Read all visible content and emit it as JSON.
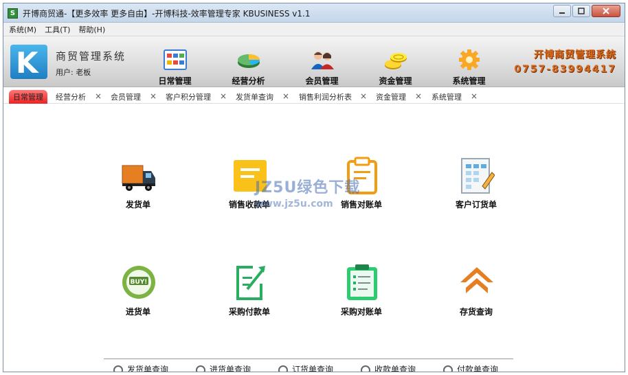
{
  "window": {
    "title": "开博商贸通-【更多效率 更多自由】-开博科技-效率管理专家  KBUSINESS v1.1",
    "icon_text": "S"
  },
  "window_controls": [
    "minimize-icon",
    "maximize-icon",
    "close-icon"
  ],
  "menu": [
    "系统(M)",
    "工具(T)",
    "帮助(H)"
  ],
  "header": {
    "logo_letter": "K",
    "app_name": "商贸管理系统",
    "user": "用户: 老板",
    "brand_title": "开博商贸管理系统",
    "brand_phone": "0757-83994417"
  },
  "nav": [
    {
      "label": "日常管理",
      "icon": "calendar-grid-icon"
    },
    {
      "label": "经营分析",
      "icon": "pie-chart-icon"
    },
    {
      "label": "会员管理",
      "icon": "users-icon"
    },
    {
      "label": "资金管理",
      "icon": "coins-icon"
    },
    {
      "label": "系统管理",
      "icon": "gear-icon"
    }
  ],
  "tabs": [
    {
      "label": "日常管理",
      "active": true
    },
    {
      "label": "经营分析"
    },
    {
      "label": "会员管理"
    },
    {
      "label": "客户积分管理"
    },
    {
      "label": "发货单查询"
    },
    {
      "label": "销售利润分析表"
    },
    {
      "label": "资金管理"
    },
    {
      "label": "系统管理"
    }
  ],
  "tiles": [
    {
      "label": "发货单",
      "icon": "truck-icon"
    },
    {
      "label": "销售收款单",
      "icon": "receipt-icon"
    },
    {
      "label": "销售对账单",
      "icon": "clipboard-icon"
    },
    {
      "label": "客户订货单",
      "icon": "order-sheet-icon"
    },
    {
      "label": "进货单",
      "icon": "buy-badge-icon"
    },
    {
      "label": "采购付款单",
      "icon": "payment-edit-icon"
    },
    {
      "label": "采购对账单",
      "icon": "checklist-icon"
    },
    {
      "label": "存货查询",
      "icon": "warehouse-icon"
    }
  ],
  "watermark": {
    "line1": "JZ5U绿色下载",
    "line2": "www.jz5u.com"
  },
  "quick_queries": [
    "发货单查询",
    "进货单查询",
    "订货单查询",
    "收款单查询",
    "付款单查询"
  ],
  "colors": {
    "header_bg": "#d9d9d9",
    "brand": "#d2691e",
    "active_tab": "#ee3333",
    "logo": "#2a8fd6"
  }
}
